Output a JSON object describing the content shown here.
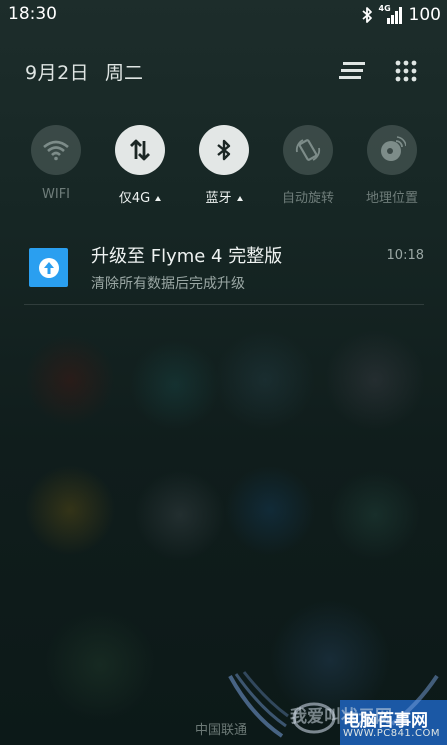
{
  "status_bar": {
    "time": "18:30",
    "network_badge": "4G",
    "battery": "100",
    "icons": [
      "bluetooth-icon",
      "signal-icon",
      "battery-icon"
    ]
  },
  "header": {
    "date": "9月2日",
    "weekday": "周二",
    "icons": [
      "list-icon",
      "grid-icon"
    ]
  },
  "toggles": [
    {
      "label": "WIFI",
      "icon": "wifi-icon",
      "state": "off"
    },
    {
      "label": "仅4G",
      "icon": "data-transfer-icon",
      "state": "on"
    },
    {
      "label": "蓝牙",
      "icon": "bluetooth-icon",
      "state": "on"
    },
    {
      "label": "自动旋转",
      "icon": "rotate-icon",
      "state": "off"
    },
    {
      "label": "地理位置",
      "icon": "location-icon",
      "state": "off"
    }
  ],
  "notification": {
    "title": "升级至 Flyme 4 完整版",
    "subtitle": "清除所有数据后完成升级",
    "time": "10:18",
    "icon": "upgrade-icon",
    "icon_color": "#2a9ff0"
  },
  "footer": {
    "carrier": "中国联通"
  },
  "watermark": {
    "text": "我爱叫状元网",
    "brand": "电脑百事网",
    "url": "WWW.PC841.COM"
  }
}
